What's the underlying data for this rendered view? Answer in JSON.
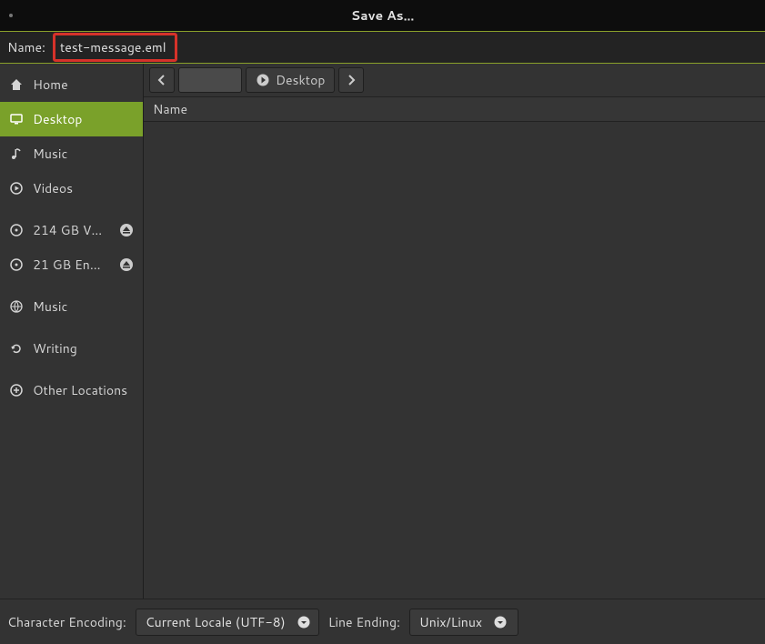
{
  "window": {
    "title": "Save As..."
  },
  "name": {
    "label": "Name:",
    "value": "test-message.eml"
  },
  "sidebar": {
    "items": [
      {
        "label": "Home",
        "icon": "home",
        "selected": false,
        "ejectable": false,
        "slug": "home"
      },
      {
        "label": "Desktop",
        "icon": "desktop",
        "selected": true,
        "ejectable": false,
        "slug": "desktop"
      },
      {
        "label": "Music",
        "icon": "music",
        "selected": false,
        "ejectable": false,
        "slug": "music"
      },
      {
        "label": "Videos",
        "icon": "video",
        "selected": false,
        "ejectable": false,
        "slug": "videos"
      },
      {
        "label": "214 GB V…",
        "icon": "drive",
        "selected": false,
        "ejectable": true,
        "slug": "volume-214gb"
      },
      {
        "label": "21 GB En…",
        "icon": "drive",
        "selected": false,
        "ejectable": true,
        "slug": "volume-21gb"
      },
      {
        "label": "Music",
        "icon": "network",
        "selected": false,
        "ejectable": false,
        "slug": "music-share"
      },
      {
        "label": "Writing",
        "icon": "sync",
        "selected": false,
        "ejectable": false,
        "slug": "writing"
      },
      {
        "label": "Other Locations",
        "icon": "plus",
        "selected": false,
        "ejectable": false,
        "slug": "other-locations"
      }
    ]
  },
  "path": {
    "current": "Desktop"
  },
  "list": {
    "header_name": "Name"
  },
  "footer": {
    "encoding_label": "Character Encoding:",
    "encoding_value": "Current Locale (UTF-8)",
    "lineend_label": "Line Ending:",
    "lineend_value": "Unix/Linux"
  }
}
